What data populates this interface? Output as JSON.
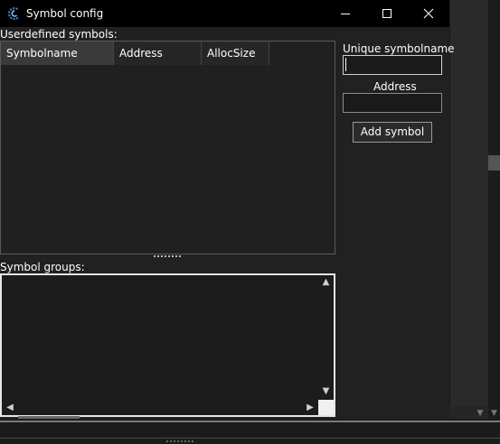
{
  "window": {
    "title": "Symbol config"
  },
  "userdefined": {
    "label": "Userdefined symbols:",
    "columns": [
      "Symbolname",
      "Address",
      "AllocSize"
    ]
  },
  "groups": {
    "label": "Symbol groups:"
  },
  "form": {
    "unique_label": "Unique symbolname",
    "unique_value": "",
    "address_label": "Address",
    "address_value": "",
    "add_button": "Add symbol"
  },
  "icons": {
    "app": "cheat-engine-icon",
    "minimize": "minimize-icon",
    "maximize": "maximize-icon",
    "close": "close-icon",
    "scroll_up": "arrow-up-icon",
    "scroll_down": "arrow-down-icon",
    "scroll_left": "arrow-left-icon",
    "scroll_right": "arrow-right-icon"
  },
  "colors": {
    "titlebar": "#000000",
    "dialog_bg": "#212121",
    "header_selected": "#3a3a3a"
  }
}
